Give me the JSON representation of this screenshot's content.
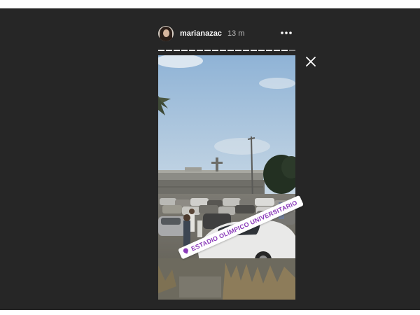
{
  "story": {
    "username": "marianazac",
    "time_ago": "13 m",
    "location_sticker": "ESTADIO OLÍMPICO UNIVERSITARIO",
    "progress_segments": 18,
    "current_segment": 17
  },
  "icons": {
    "more": "more-options-icon",
    "close": "close-icon",
    "location": "location-pin-icon"
  },
  "colors": {
    "viewer_bg": "#262626",
    "sticker_text": "#8a3ab9"
  }
}
